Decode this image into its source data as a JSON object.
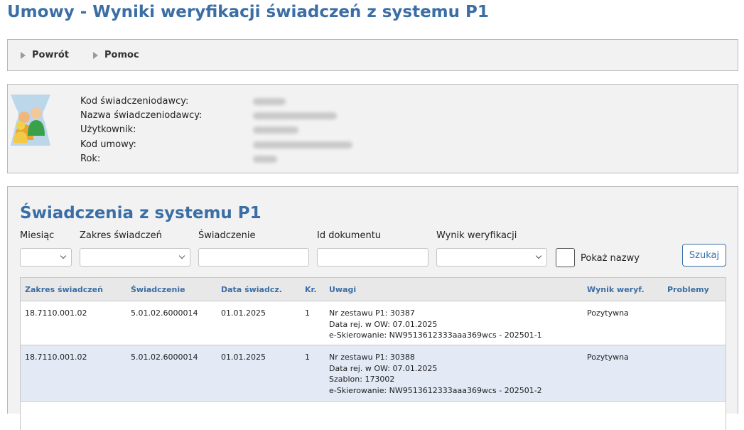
{
  "page": {
    "title": "Umowy - Wyniki weryfikacji świadczeń z systemu P1"
  },
  "nav": {
    "back": "Powrót",
    "help": "Pomoc"
  },
  "info": {
    "labels": {
      "provider_code": "Kod świadczeniodawcy:",
      "provider_name": "Nazwa świadczeniodawcy:",
      "user": "Użytkownik:",
      "contract_code": "Kod umowy:",
      "year": "Rok:"
    }
  },
  "section": {
    "title": "Świadczenia z systemu P1"
  },
  "filters": {
    "month_label": "Miesiąc",
    "scope_label": "Zakres świadczeń",
    "service_label": "Świadczenie",
    "doc_id_label": "Id dokumentu",
    "result_label": "Wynik weryfikacji",
    "show_names_label": "Pokaż nazwy",
    "search_button": "Szukaj"
  },
  "table": {
    "columns": [
      "Zakres świadczeń",
      "Świadczenie",
      "Data świadcz.",
      "Kr.",
      "Uwagi",
      "Wynik weryf.",
      "Problemy"
    ],
    "rows": [
      {
        "scope": "18.7110.001.02",
        "service": "5.01.02.6000014",
        "date": "01.01.2025",
        "kr": "1",
        "notes": [
          "Nr zestawu P1: 30387",
          "Data rej. w OW: 07.01.2025",
          "e-Skierowanie: NW9513612333aaa369wcs - 202501-1"
        ],
        "result": "Pozytywna",
        "problems": ""
      },
      {
        "scope": "18.7110.001.02",
        "service": "5.01.02.6000014",
        "date": "01.01.2025",
        "kr": "1",
        "notes": [
          "Nr zestawu P1: 30388",
          "Data rej. w OW: 07.01.2025",
          "Szablon: 173002",
          "e-Skierowanie: NW9513612333aaa369wcs - 202501-2"
        ],
        "result": "Pozytywna",
        "problems": ""
      }
    ]
  },
  "colors": {
    "accent": "#3a6ea5",
    "panel_bg": "#f3f2f3",
    "row_highlight": "#e3eaf6"
  },
  "icons": {
    "app": "users-icon",
    "nav_arrow": "triangle-right-icon",
    "dropdown": "chevron-down-icon"
  }
}
